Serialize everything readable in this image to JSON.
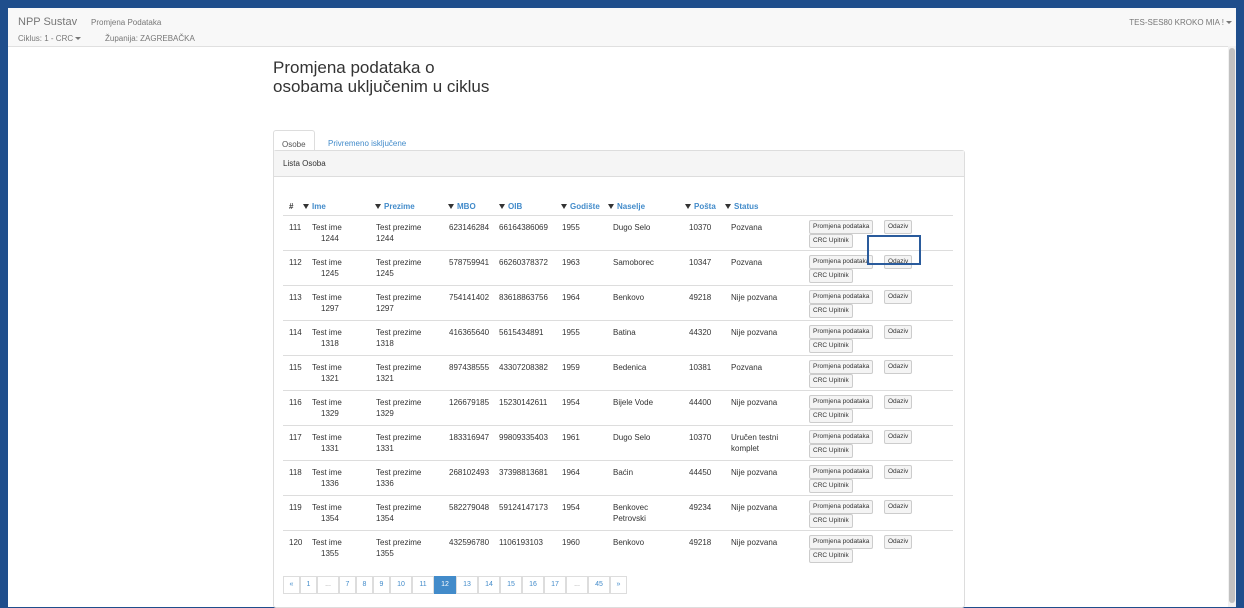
{
  "navbar": {
    "brand": "NPP Sustav",
    "link": "Promjena Podataka",
    "user": "TES-SES80 KROKO MIA !",
    "ciklus": "Ciklus: 1 - CRC",
    "zupanija": "Županija: ZAGREBAČKA"
  },
  "page_title": "Promjena podataka o osobama uključenim u ciklus",
  "tabs": [
    "Osobe",
    "Privremeno isključene"
  ],
  "panel_title": "Lista Osoba",
  "columns": {
    "num": "#",
    "ime": "Ime",
    "prezime": "Prezime",
    "mbo": "MBO",
    "oib": "OIB",
    "godiste": "Godište",
    "naselje": "Naselje",
    "posta": "Pošta",
    "status": "Status"
  },
  "buttons": {
    "promjena": "Promjena podataka",
    "odaziv": "Odaziv",
    "crc": "CRC Upitnik"
  },
  "rows": [
    {
      "num": "111",
      "ime1": "Test ime",
      "ime2": "1244",
      "prez1": "Test prezime",
      "prez2": "1244",
      "mbo": "623146284",
      "oib": "66164386069",
      "god": "1955",
      "nas1": "Dugo Selo",
      "nas2": "",
      "posta": "10370",
      "stat1": "Pozvana",
      "stat2": ""
    },
    {
      "num": "112",
      "ime1": "Test ime",
      "ime2": "1245",
      "prez1": "Test prezime",
      "prez2": "1245",
      "mbo": "578759941",
      "oib": "66260378372",
      "god": "1963",
      "nas1": "Samoborec",
      "nas2": "",
      "posta": "10347",
      "stat1": "Pozvana",
      "stat2": ""
    },
    {
      "num": "113",
      "ime1": "Test ime",
      "ime2": "1297",
      "prez1": "Test prezime",
      "prez2": "1297",
      "mbo": "754141402",
      "oib": "83618863756",
      "god": "1964",
      "nas1": "Benkovo",
      "nas2": "",
      "posta": "49218",
      "stat1": "Nije pozvana",
      "stat2": ""
    },
    {
      "num": "114",
      "ime1": "Test ime",
      "ime2": "1318",
      "prez1": "Test prezime",
      "prez2": "1318",
      "mbo": "416365640",
      "oib": "5615434891",
      "god": "1955",
      "nas1": "Batina",
      "nas2": "",
      "posta": "44320",
      "stat1": "Nije pozvana",
      "stat2": ""
    },
    {
      "num": "115",
      "ime1": "Test ime",
      "ime2": "1321",
      "prez1": "Test prezime",
      "prez2": "1321",
      "mbo": "897438555",
      "oib": "43307208382",
      "god": "1959",
      "nas1": "Bedenica",
      "nas2": "",
      "posta": "10381",
      "stat1": "Pozvana",
      "stat2": ""
    },
    {
      "num": "116",
      "ime1": "Test ime",
      "ime2": "1329",
      "prez1": "Test prezime",
      "prez2": "1329",
      "mbo": "126679185",
      "oib": "15230142611",
      "god": "1954",
      "nas1": "Bijele Vode",
      "nas2": "",
      "posta": "44400",
      "stat1": "Nije pozvana",
      "stat2": ""
    },
    {
      "num": "117",
      "ime1": "Test ime",
      "ime2": "1331",
      "prez1": "Test prezime",
      "prez2": "1331",
      "mbo": "183316947",
      "oib": "99809335403",
      "god": "1961",
      "nas1": "Dugo Selo",
      "nas2": "",
      "posta": "10370",
      "stat1": "Uručen testni",
      "stat2": "komplet"
    },
    {
      "num": "118",
      "ime1": "Test ime",
      "ime2": "1336",
      "prez1": "Test prezime",
      "prez2": "1336",
      "mbo": "268102493",
      "oib": "37398813681",
      "god": "1964",
      "nas1": "Baćin",
      "nas2": "",
      "posta": "44450",
      "stat1": "Nije pozvana",
      "stat2": ""
    },
    {
      "num": "119",
      "ime1": "Test ime",
      "ime2": "1354",
      "prez1": "Test prezime",
      "prez2": "1354",
      "mbo": "582279048",
      "oib": "59124147173",
      "god": "1954",
      "nas1": "Benkovec",
      "nas2": "Petrovski",
      "posta": "49234",
      "stat1": "Nije pozvana",
      "stat2": ""
    },
    {
      "num": "120",
      "ime1": "Test ime",
      "ime2": "1355",
      "prez1": "Test prezime",
      "prez2": "1355",
      "mbo": "432596780",
      "oib": "1106193103",
      "god": "1960",
      "nas1": "Benkovo",
      "nas2": "",
      "posta": "49218",
      "stat1": "Nije pozvana",
      "stat2": ""
    }
  ],
  "pagination": [
    "«",
    "1",
    "...",
    "7",
    "8",
    "9",
    "10",
    "11",
    "12",
    "13",
    "14",
    "15",
    "16",
    "17",
    "...",
    "45",
    "»"
  ],
  "pagination_active": "12",
  "colors": {
    "accent": "#428bca",
    "highlight": "#2a5b9c",
    "frame": "#1f4e8c"
  }
}
